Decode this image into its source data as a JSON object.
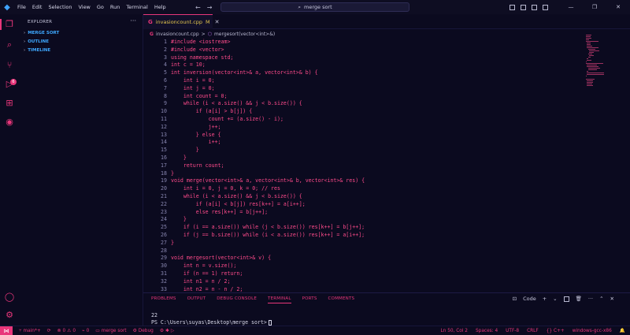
{
  "titlebar": {
    "menu": [
      "File",
      "Edit",
      "Selection",
      "View",
      "Go",
      "Run",
      "Terminal",
      "Help"
    ],
    "search_text": "merge sort",
    "back": "←",
    "forward": "→",
    "minimize": "—",
    "maximize": "❐",
    "close": "✕"
  },
  "sidebar": {
    "title": "EXPLORER",
    "more": "···",
    "sections": [
      "MERGE SORT",
      "OUTLINE",
      "TIMELINE"
    ],
    "scm_badge": "6"
  },
  "editor": {
    "tab_label": "invasioncount.cpp",
    "tab_modified": "M",
    "tab_icon": "G",
    "breadcrumb_file": "invasioncount.cpp",
    "breadcrumb_sep": ">",
    "breadcrumb_symbol": "mergesort(vector<int>&)",
    "lines": [
      {
        "n": "1",
        "code": "#include <iostream>"
      },
      {
        "n": "2",
        "code": "#include <vector>"
      },
      {
        "n": "3",
        "code": "using namespace std;"
      },
      {
        "n": "4",
        "code": "int c = 10;"
      },
      {
        "n": "5",
        "code": "int inversion(vector<int>& a, vector<int>& b) {"
      },
      {
        "n": "6",
        "code": "    int i = 0;"
      },
      {
        "n": "7",
        "code": "    int j = 0;"
      },
      {
        "n": "8",
        "code": "    int count = 0;"
      },
      {
        "n": "9",
        "code": "    while (i < a.size() && j < b.size()) {"
      },
      {
        "n": "10",
        "code": "        if (a[i] > b[j]) {"
      },
      {
        "n": "11",
        "code": "            count += (a.size() - i);"
      },
      {
        "n": "12",
        "code": "            j++;"
      },
      {
        "n": "13",
        "code": "        } else {"
      },
      {
        "n": "14",
        "code": "            i++;"
      },
      {
        "n": "15",
        "code": "        }"
      },
      {
        "n": "16",
        "code": "    }"
      },
      {
        "n": "17",
        "code": "    return count;"
      },
      {
        "n": "18",
        "code": "}"
      },
      {
        "n": "19",
        "code": "void merge(vector<int>& a, vector<int>& b, vector<int>& res) {"
      },
      {
        "n": "20",
        "code": "    int i = 0, j = 0, k = 0; // res"
      },
      {
        "n": "21",
        "code": "    while (i < a.size() && j < b.size()) {"
      },
      {
        "n": "22",
        "code": "        if (a[i] < b[j]) res[k++] = a[i++];"
      },
      {
        "n": "23",
        "code": "        else res[k++] = b[j++];"
      },
      {
        "n": "24",
        "code": "    }"
      },
      {
        "n": "25",
        "code": "    if (i == a.size()) while (j < b.size()) res[k++] = b[j++];"
      },
      {
        "n": "26",
        "code": "    if (j == b.size()) while (i < a.size()) res[k++] = a[i++];"
      },
      {
        "n": "27",
        "code": "}"
      },
      {
        "n": "28",
        "code": ""
      },
      {
        "n": "29",
        "code": "void mergesort(vector<int>& v) {"
      },
      {
        "n": "30",
        "code": "    int n = v.size();"
      },
      {
        "n": "31",
        "code": "    if (n == 1) return;"
      },
      {
        "n": "32",
        "code": "    int n1 = n / 2;"
      },
      {
        "n": "33",
        "code": "    int n2 = n - n / 2;"
      }
    ]
  },
  "panel": {
    "tabs": [
      "PROBLEMS",
      "OUTPUT",
      "DEBUG CONSOLE",
      "TERMINAL",
      "PORTS",
      "COMMENTS"
    ],
    "active_tab": "TERMINAL",
    "shell": "Code",
    "terminal_output": "22",
    "terminal_prompt": "PS C:\\Users\\suyas\\Desktop\\merge sort>"
  },
  "status": {
    "remote": "⋈",
    "branch": "main*+",
    "sync": "⟳",
    "errors": "0",
    "warnings": "0",
    "ports": "0",
    "folder": "merge sort",
    "debug": "Debug",
    "position": "Ln 50, Col 2",
    "spaces": "Spaces: 4",
    "encoding": "UTF-8",
    "eol": "CRLF",
    "language": "C++",
    "config": "windows-gcc-x86"
  },
  "colors": {
    "accent": "#e8367a",
    "keyword_pink": "#ff4b8b",
    "link_blue": "#3ea8ff",
    "tab_yellow": "#e3c64d",
    "background": "#0b0a1f"
  }
}
